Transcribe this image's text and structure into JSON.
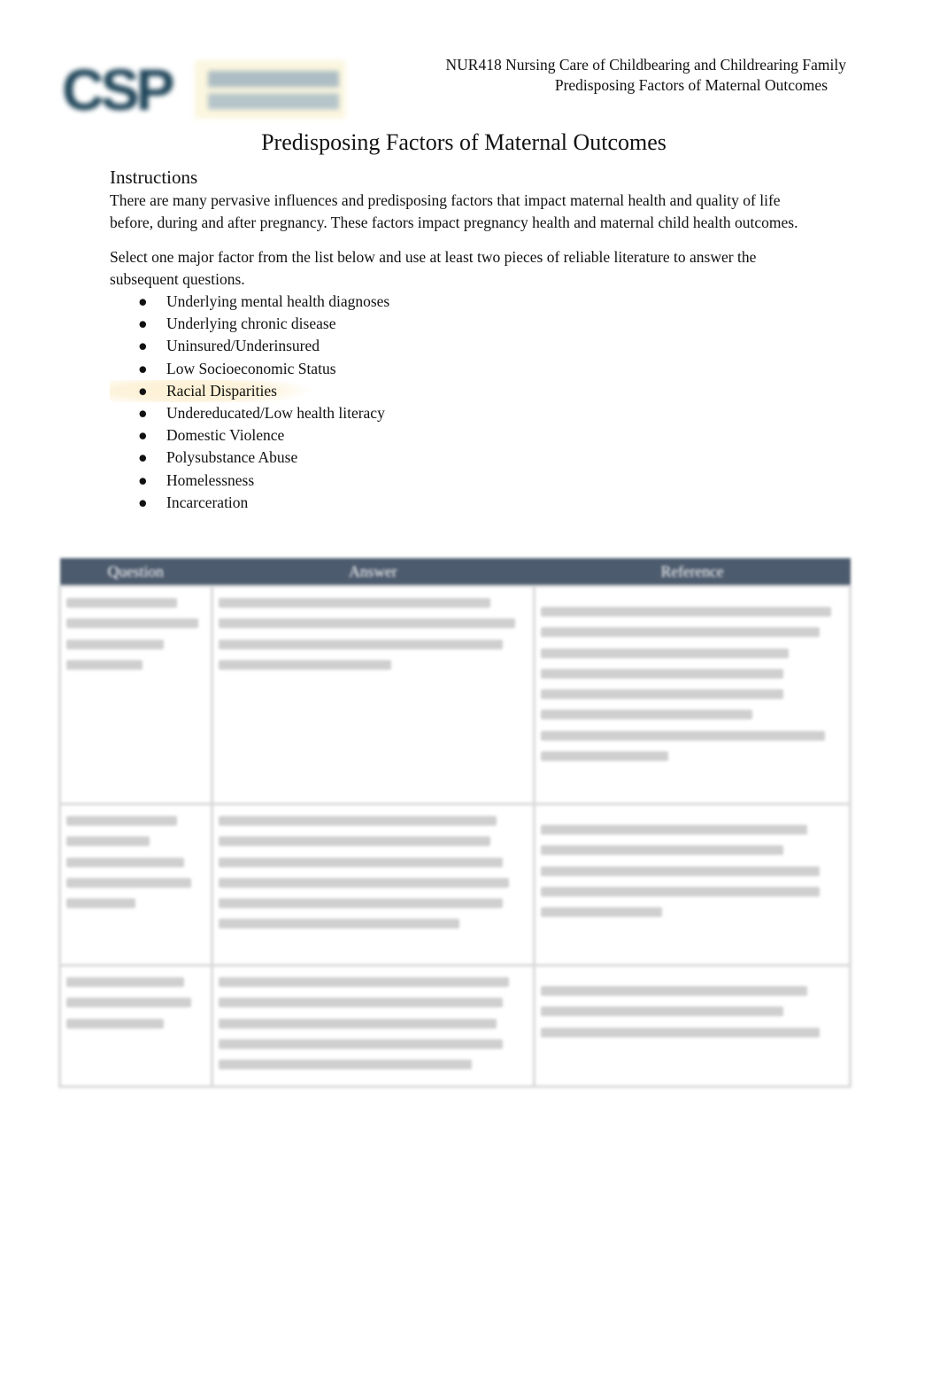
{
  "header": {
    "logo_text": "CSP",
    "logo_subtext": "CONCORDIA ST. PAUL",
    "course_line": "NUR418 Nursing Care of Childbearing and Childrearing Family",
    "subtitle_line": "Predisposing Factors of Maternal Outcomes"
  },
  "document": {
    "title": "Predisposing Factors of Maternal Outcomes",
    "instructions_heading": "Instructions",
    "intro_paragraph": "There are many pervasive influences and predisposing factors that impact maternal health and quality of life before, during and after pregnancy. These factors impact pregnancy health and maternal child health outcomes.",
    "select_paragraph": "Select one major factor from the list below and use at least two pieces of reliable literature to answer the subsequent questions.",
    "bullet_glyph": "●",
    "factors": [
      "Underlying mental health diagnoses",
      "Underlying chronic disease",
      "Uninsured/Underinsured",
      "Low Socioeconomic Status",
      "Racial Disparities",
      "Undereducated/Low health literacy",
      "Domestic Violence",
      "Polysubstance Abuse",
      "Homelessness",
      "Incarceration"
    ],
    "highlighted_factor": "Racial Disparities"
  },
  "table": {
    "headers": [
      "Question",
      "Answer",
      "Reference"
    ],
    "header_color": "#4d5b6e",
    "rows_blurred": true,
    "rows": [
      {
        "question_lines": 4,
        "answer_lines": 4,
        "reference_lines": 8
      },
      {
        "question_lines": 5,
        "answer_lines": 6,
        "reference_lines": 5
      },
      {
        "question_lines": 3,
        "answer_lines": 5,
        "reference_lines": 3
      }
    ]
  }
}
